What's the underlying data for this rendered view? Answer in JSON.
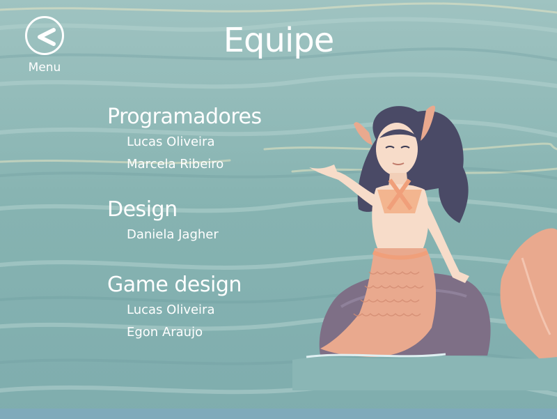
{
  "screen": {
    "title": "Equipe",
    "back_button": {
      "label": "Menu",
      "icon": "chevron-left-icon"
    }
  },
  "credits": {
    "sections": [
      {
        "heading": "Programadores",
        "members": [
          "Lucas Oliveira",
          "Marcela Ribeiro"
        ]
      },
      {
        "heading": "Design",
        "members": [
          "Daniela Jagher"
        ]
      },
      {
        "heading": "Game design",
        "members": [
          "Lucas Oliveira",
          "Egon Araujo"
        ]
      }
    ]
  },
  "colors": {
    "water": "#8fb7b5",
    "text": "#ffffff",
    "mermaid_tail": "#e9a98e",
    "mermaid_hair": "#4a4a66",
    "rock": "#7e6f86"
  }
}
